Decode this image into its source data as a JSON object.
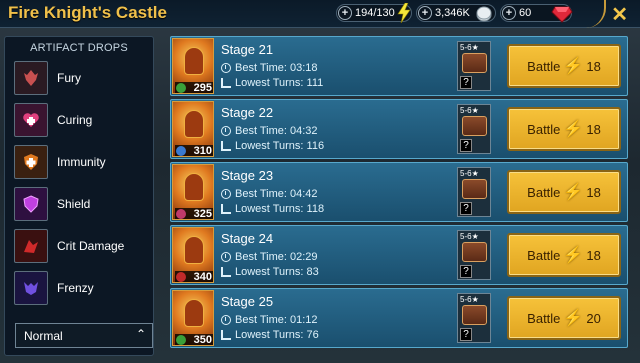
{
  "header": {
    "title": "Fire Knight's Castle",
    "energy": "194/130",
    "silver": "3,346K",
    "gems": "60"
  },
  "sidebar": {
    "header": "ARTIFACT DROPS",
    "items": [
      {
        "label": "Fury",
        "icon": "fury-icon",
        "color": "#c0403a"
      },
      {
        "label": "Curing",
        "icon": "curing-icon",
        "color": "#d8387a"
      },
      {
        "label": "Immunity",
        "icon": "immunity-icon",
        "color": "#e07a20"
      },
      {
        "label": "Shield",
        "icon": "shield-icon",
        "color": "#b038d0"
      },
      {
        "label": "Crit Damage",
        "icon": "crit-damage-icon",
        "color": "#c02a2a"
      },
      {
        "label": "Frenzy",
        "icon": "frenzy-icon",
        "color": "#6040d0"
      }
    ],
    "difficulty": "Normal"
  },
  "stages": [
    {
      "name": "Stage 21",
      "best_time": "Best Time: 03:18",
      "lowest_turns": "Lowest Turns: 111",
      "level": "295",
      "rank": "5-6",
      "battle_label": "Battle",
      "cost": "18",
      "elem": "#3aa03a"
    },
    {
      "name": "Stage 22",
      "best_time": "Best Time: 04:32",
      "lowest_turns": "Lowest Turns: 116",
      "level": "310",
      "rank": "5-6",
      "battle_label": "Battle",
      "cost": "18",
      "elem": "#3a7ad0"
    },
    {
      "name": "Stage 23",
      "best_time": "Best Time: 04:42",
      "lowest_turns": "Lowest Turns: 118",
      "level": "325",
      "rank": "5-6",
      "battle_label": "Battle",
      "cost": "18",
      "elem": "#c03a6a"
    },
    {
      "name": "Stage 24",
      "best_time": "Best Time: 02:29",
      "lowest_turns": "Lowest Turns: 83",
      "level": "340",
      "rank": "5-6",
      "battle_label": "Battle",
      "cost": "18",
      "elem": "#c02a2a"
    },
    {
      "name": "Stage 25",
      "best_time": "Best Time: 01:12",
      "lowest_turns": "Lowest Turns: 76",
      "level": "350",
      "rank": "5-6",
      "battle_label": "Battle",
      "cost": "20",
      "elem": "#3aa03a"
    }
  ],
  "colors": {
    "title": "#f0c04a",
    "battle_button": "#f6c23a",
    "row_bg": "#2a6c90"
  }
}
